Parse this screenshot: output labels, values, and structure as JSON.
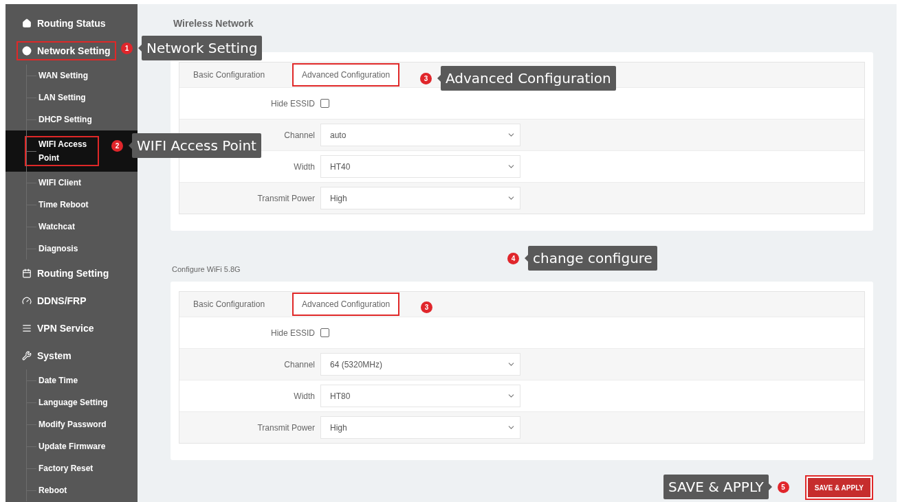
{
  "sidebar": {
    "items": [
      {
        "label": "Routing Status",
        "selected": false,
        "annotated": false
      },
      {
        "label": "Network Setting",
        "selected": false,
        "annotated": true,
        "children": [
          {
            "label": "WAN Setting",
            "selected": false,
            "annotated": false
          },
          {
            "label": "LAN Setting",
            "selected": false,
            "annotated": false
          },
          {
            "label": "DHCP Setting",
            "selected": false,
            "annotated": false
          },
          {
            "label": "WIFI Access Point",
            "selected": true,
            "annotated": true
          },
          {
            "label": "WIFI Client",
            "selected": false,
            "annotated": false
          },
          {
            "label": "Time Reboot",
            "selected": false,
            "annotated": false
          },
          {
            "label": "Watchcat",
            "selected": false,
            "annotated": false
          },
          {
            "label": "Diagnosis",
            "selected": false,
            "annotated": false
          }
        ]
      },
      {
        "label": "Routing Setting",
        "selected": false,
        "annotated": false
      },
      {
        "label": "DDNS/FRP",
        "selected": false,
        "annotated": false
      },
      {
        "label": "VPN Service",
        "selected": false,
        "annotated": false
      },
      {
        "label": "System",
        "selected": false,
        "annotated": false,
        "children": [
          {
            "label": "Date Time",
            "selected": false,
            "annotated": false
          },
          {
            "label": "Language Setting",
            "selected": false,
            "annotated": false
          },
          {
            "label": "Modify Password",
            "selected": false,
            "annotated": false
          },
          {
            "label": "Update Firmware",
            "selected": false,
            "annotated": false
          },
          {
            "label": "Factory Reset",
            "selected": false,
            "annotated": false
          },
          {
            "label": "Reboot",
            "selected": false,
            "annotated": false
          }
        ]
      }
    ]
  },
  "page_title": "Wireless Network",
  "sections": [
    {
      "tabs": [
        {
          "label": "Basic Configuration",
          "selected": false,
          "annotated": false
        },
        {
          "label": "Advanced Configuration",
          "selected": true,
          "annotated": true
        }
      ],
      "fields": [
        {
          "kind": "checkbox",
          "label": "Hide ESSID",
          "checked": false
        },
        {
          "kind": "select",
          "label": "Channel",
          "value": "auto"
        },
        {
          "kind": "select",
          "label": "Width",
          "value": "HT40"
        },
        {
          "kind": "select",
          "label": "Transmit Power",
          "value": "High"
        }
      ]
    },
    {
      "heading": "Configure WiFi 5.8G",
      "tabs": [
        {
          "label": "Basic Configuration",
          "selected": false,
          "annotated": false
        },
        {
          "label": "Advanced Configuration",
          "selected": true,
          "annotated": true
        }
      ],
      "fields": [
        {
          "kind": "checkbox",
          "label": "Hide ESSID",
          "checked": false
        },
        {
          "kind": "select",
          "label": "Channel",
          "value": "64 (5320MHz)"
        },
        {
          "kind": "select",
          "label": "Width",
          "value": "HT80"
        },
        {
          "kind": "select",
          "label": "Transmit Power",
          "value": "High"
        }
      ]
    }
  ],
  "save_button": {
    "label": "SAVE & APPLY",
    "annotated": true
  },
  "callouts": [
    {
      "number": "1",
      "text": "Network Setting"
    },
    {
      "number": "2",
      "text": "WIFI Access Point"
    },
    {
      "number": "3",
      "text": "Advanced Configuration"
    },
    {
      "number": "3"
    },
    {
      "number": "4",
      "text": "change configure"
    },
    {
      "number": "5",
      "text": "SAVE & APPLY"
    }
  ]
}
